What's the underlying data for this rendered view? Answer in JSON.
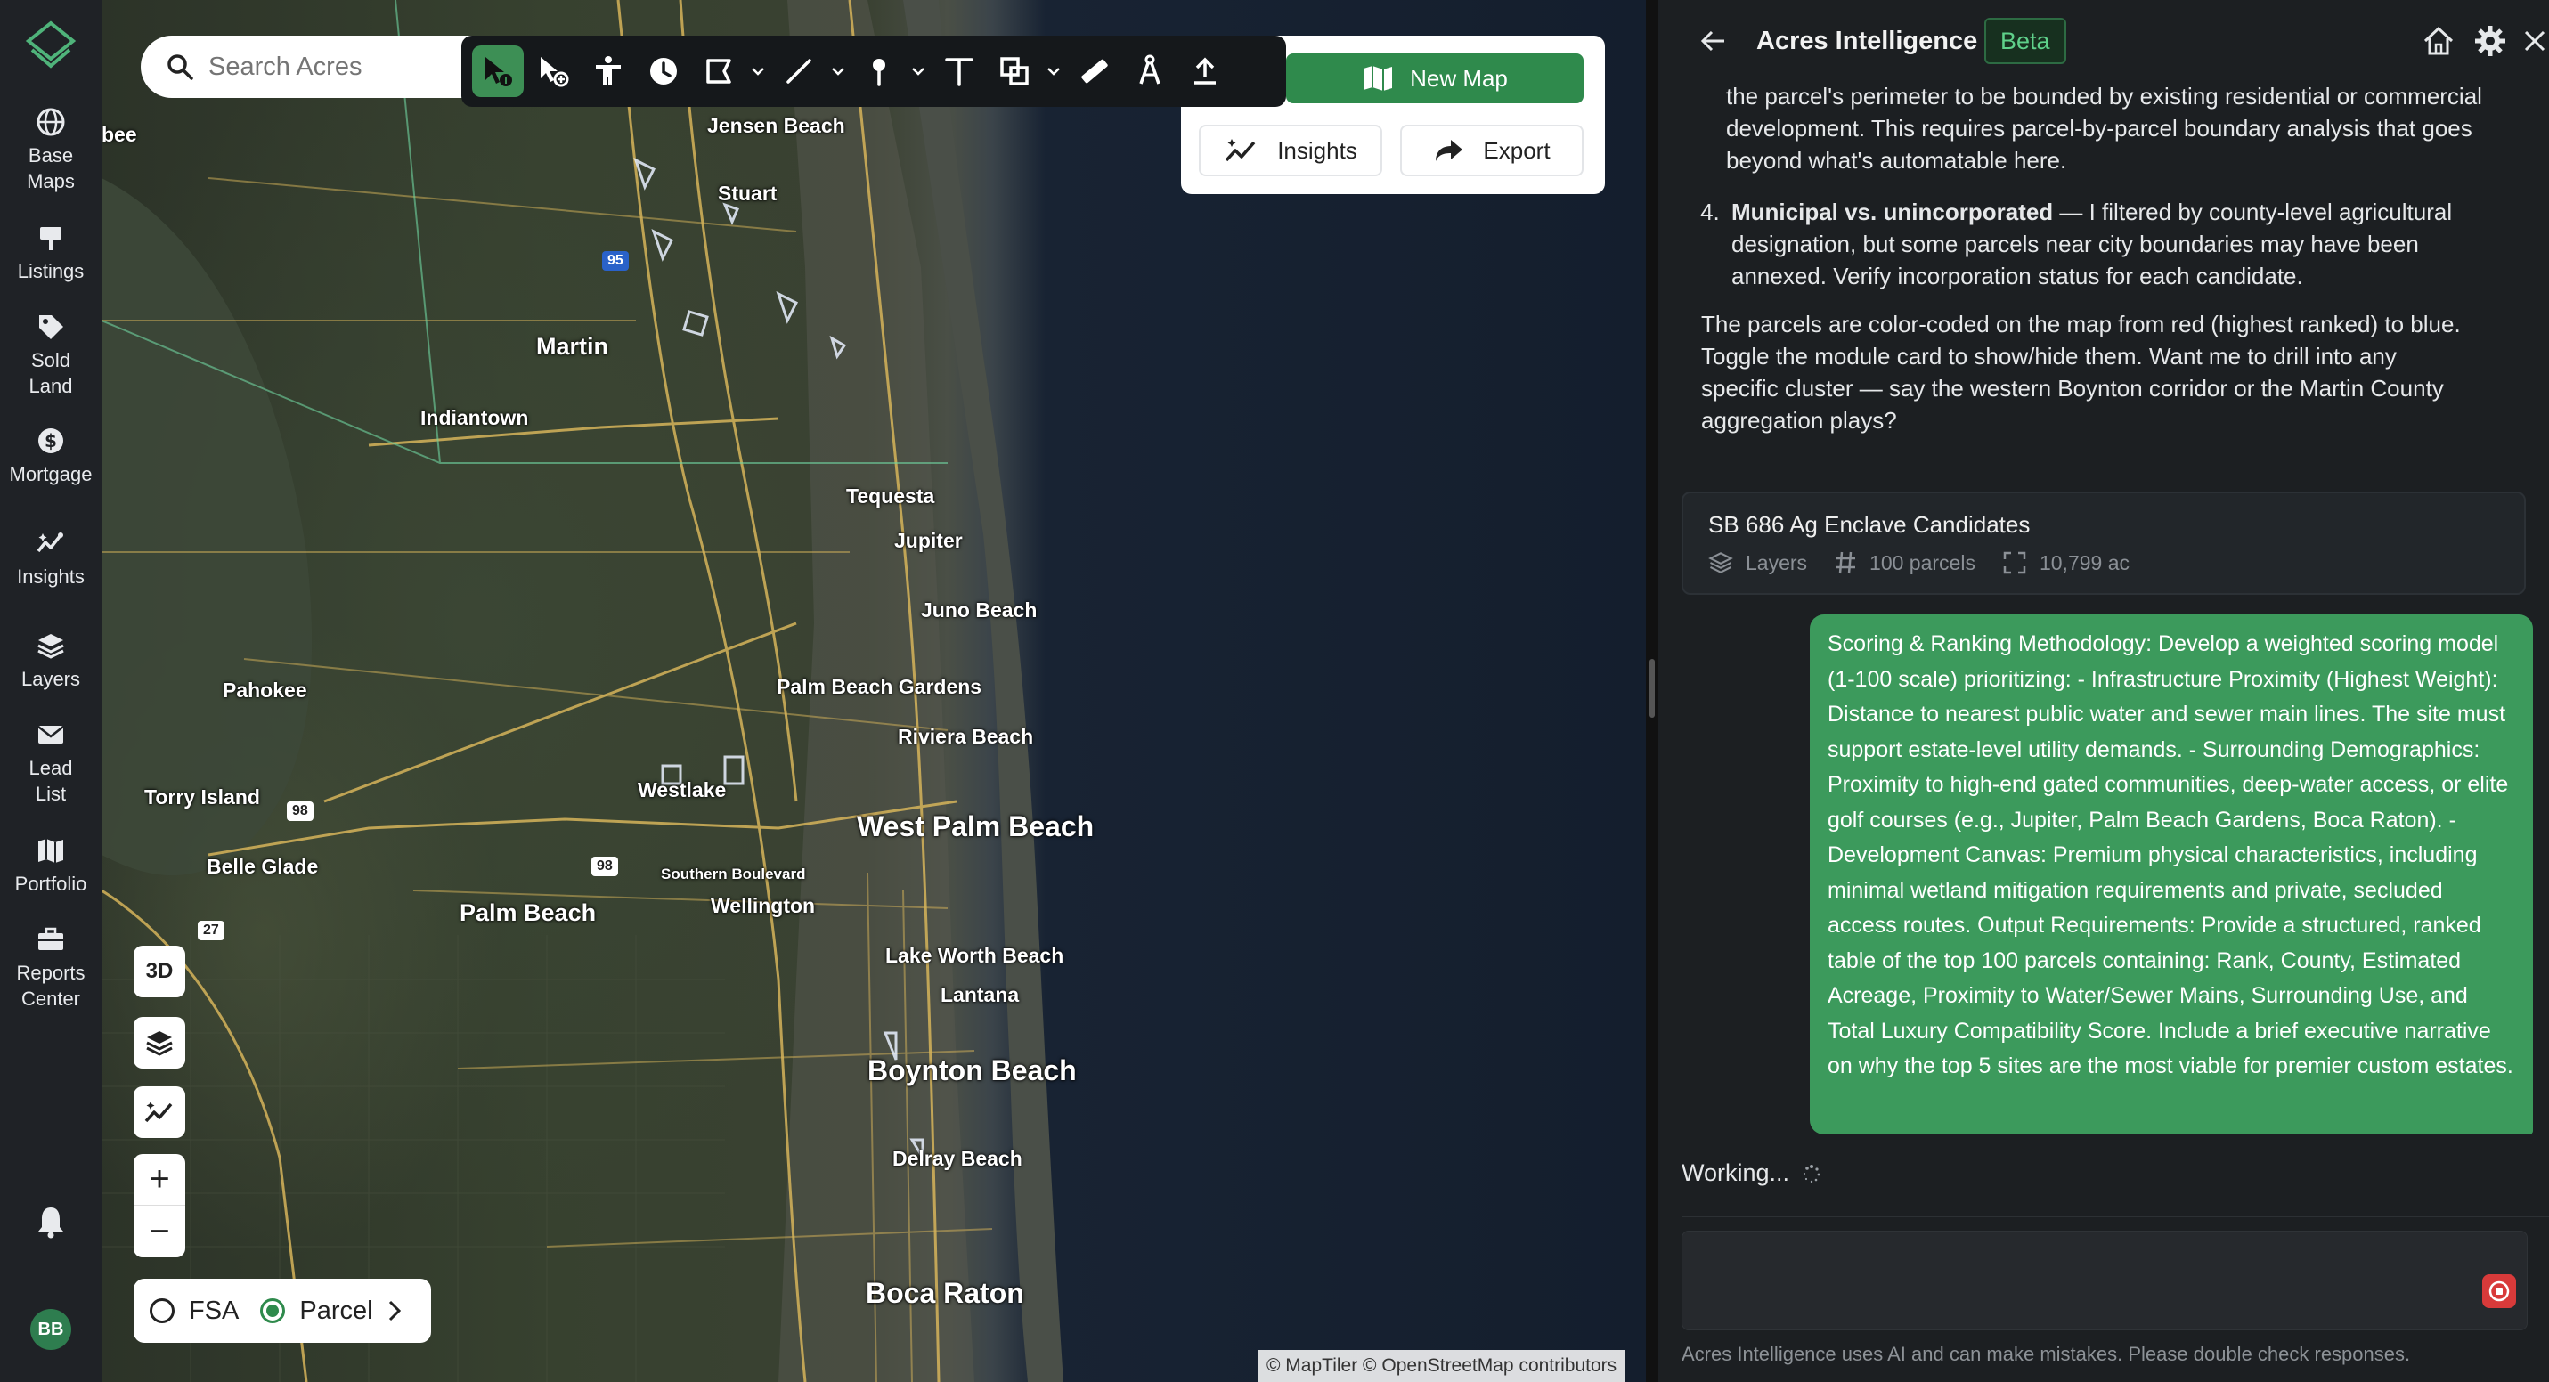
{
  "rail": {
    "items": [
      {
        "label_1": "Base",
        "label_2": "Maps",
        "icon": "globe-icon"
      },
      {
        "label_1": "Listings",
        "icon": "signpost-icon"
      },
      {
        "label_1": "Sold",
        "label_2": "Land",
        "icon": "tag-icon"
      },
      {
        "label_1": "Mortgage",
        "icon": "dollar-icon"
      },
      {
        "label_1": "Insights",
        "icon": "sparkline-icon"
      },
      {
        "label_1": "Layers",
        "icon": "layers-icon"
      },
      {
        "label_1": "Lead",
        "label_2": "List",
        "icon": "mail-icon"
      },
      {
        "label_1": "Portfolio",
        "icon": "map-icon"
      },
      {
        "label_1": "Reports",
        "label_2": "Center",
        "icon": "briefcase-icon"
      }
    ],
    "avatar": "BB"
  },
  "search": {
    "placeholder": "Search Acres"
  },
  "map_panel": {
    "new_map": "New Map",
    "insights": "Insights",
    "export": "Export"
  },
  "map_controls": {
    "three_d": "3D",
    "zoom_in": "+",
    "zoom_out": "−"
  },
  "layer_toggle": {
    "fsa": "FSA",
    "parcel": "Parcel",
    "selected": "Parcel"
  },
  "map_labels": [
    {
      "text": "bee",
      "size": "sm"
    },
    {
      "text": "Jensen Beach",
      "size": "sm"
    },
    {
      "text": "Stuart",
      "size": "sm"
    },
    {
      "text": "Martin",
      "size": "md"
    },
    {
      "text": "Indiantown",
      "size": "sm"
    },
    {
      "text": "Tequesta",
      "size": "sm"
    },
    {
      "text": "Jupiter",
      "size": "sm"
    },
    {
      "text": "Juno Beach",
      "size": "sm"
    },
    {
      "text": "Pahokee",
      "size": "sm"
    },
    {
      "text": "Palm Beach Gardens",
      "size": "sm"
    },
    {
      "text": "Riviera Beach",
      "size": "sm"
    },
    {
      "text": "Torry Island",
      "size": "sm"
    },
    {
      "text": "Westlake",
      "size": "sm"
    },
    {
      "text": "West Palm Beach",
      "size": "lg"
    },
    {
      "text": "Belle Glade",
      "size": "sm"
    },
    {
      "text": "Southern Boulevard",
      "size": "xs"
    },
    {
      "text": "Wellington",
      "size": "sm"
    },
    {
      "text": "Palm Beach",
      "size": "md"
    },
    {
      "text": "Lake Worth Beach",
      "size": "sm"
    },
    {
      "text": "Lantana",
      "size": "sm"
    },
    {
      "text": "Boynton Beach",
      "size": "lg"
    },
    {
      "text": "Delray Beach",
      "size": "sm"
    },
    {
      "text": "Boca Raton",
      "size": "lg"
    }
  ],
  "road_shields": [
    "95",
    "98",
    "98",
    "27"
  ],
  "attribution": "© MapTiler © OpenStreetMap contributors",
  "panel": {
    "title": "Acres Intelligence",
    "badge": "Beta",
    "intro_text": "the parcel's perimeter to be bounded by existing residential or commercial development. This requires parcel-by-parcel boundary analysis that goes beyond what's automatable here.",
    "item4_bold": "Municipal vs. unincorporated",
    "item4_text": " — I filtered by county-level agricultural designation, but some parcels near city boundaries may have been annexed. Verify incorporation status for each candidate.",
    "closing_text": "The parcels are color-coded on the map from red (highest ranked) to blue. Toggle the module card to show/hide them. Want me to drill into any specific cluster — say the western Boynton corridor or the Martin County aggregation plays?",
    "card": {
      "title": "SB 686 Ag Enclave Candidates",
      "layers": "Layers",
      "parcels": "100 parcels",
      "acres": "10,799 ac"
    },
    "user_message": "Scoring & Ranking Methodology: Develop a weighted scoring model (1-100 scale) prioritizing: - Infrastructure Proximity (Highest Weight): Distance to nearest public water and sewer main lines. The site must support estate-level utility demands. - Surrounding Demographics: Proximity to high-end gated communities, deep-water access, or elite golf courses (e.g., Jupiter, Palm Beach Gardens, Boca Raton). - Development Canvas: Premium physical characteristics, including minimal wetland mitigation requirements and private, secluded access routes. Output Requirements: Provide a structured, ranked table of the top 100 parcels containing: Rank, County, Estimated Acreage, Proximity to Water/Sewer Mains, Surrounding Use, and Total Luxury Compatibility Score. Include a brief executive narrative on why the top 5 sites are the most viable for premier custom estates.",
    "status": "Working...",
    "disclaimer": "Acres Intelligence uses AI and can make mistakes. Please double check responses."
  }
}
